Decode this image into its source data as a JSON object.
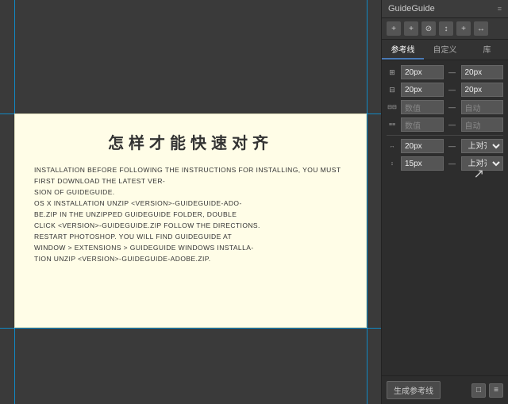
{
  "canvas": {
    "background": "#3a3a3a",
    "guide_color": "#00aaff"
  },
  "content_box": {
    "title": "怎样才能快速对齐",
    "text": "INSTALLATION BEFORE FOLLOWING THE INSTRUCTIONS FOR INSTALLING, YOU MUST FIRST DOWNLOAD THE LATEST VERSION OF GUIDEGUIDE.\nOS X INSTALLATION UNZIP <VERSION>-GUIDEGUIDE-ADOBE.ZIP IN THE UNZIPPED GUIDEGUIDE FOLDER, DOUBLE CLICK <VERSION>-GUIDEGUIDE.ZIP FOLLOW THE DIRECTIONS. RESTART PHOTOSHOP. YOU WILL FIND GUIDEGUIDE AT WINDOW > EXTENSIONS > GUIDEGUIDE WINDOWS INSTALLATION UNZIP <VERSION>-GUIDEGUIDE-ADOBE.ZIP."
  },
  "panel": {
    "title": "GuideGuide",
    "toolbar_buttons": [
      "+",
      "+",
      "⊘",
      "↕",
      "+",
      "↔"
    ],
    "tabs": [
      {
        "label": "参考线",
        "active": true
      },
      {
        "label": "自定义",
        "active": false
      },
      {
        "label": "库",
        "active": false
      }
    ],
    "fields": [
      {
        "icon": "H",
        "left_value": "20px",
        "sep": "—",
        "right_value": "20px"
      },
      {
        "icon": "H",
        "left_value": "20px",
        "sep": "—",
        "right_value": "20px"
      },
      {
        "icon": "cols",
        "left_value": "数值",
        "sep": "—",
        "right_value": "自动"
      },
      {
        "icon": "rows",
        "left_value": "数值",
        "sep": "—",
        "right_value": "自动"
      },
      {
        "icon": "W",
        "left_value": "20px",
        "sep": "—",
        "right_value": "上对齐"
      },
      {
        "icon": "H2",
        "left_value": "15px",
        "sep": "—",
        "right_value": "上对齐"
      }
    ],
    "generate_btn": "生成参考线",
    "footer_icons": [
      "□",
      "≡"
    ]
  }
}
